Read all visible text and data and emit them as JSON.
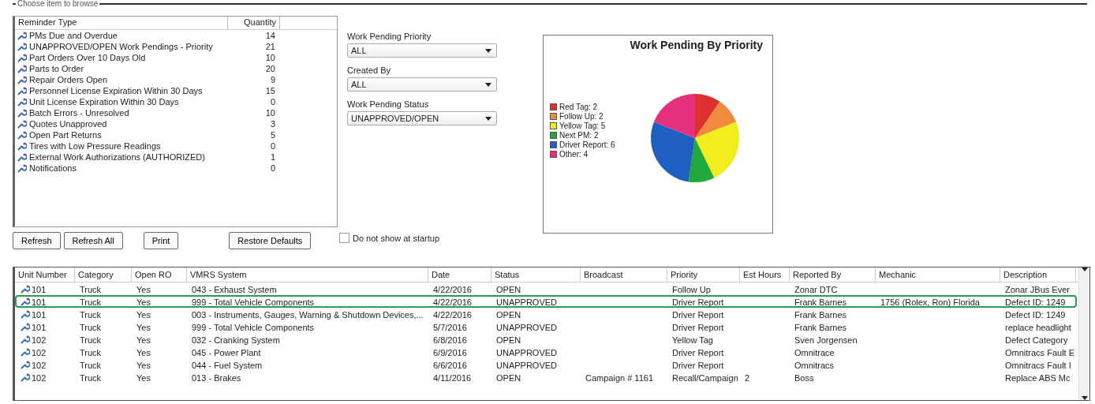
{
  "browse_group": {
    "title": "Choose item to browse"
  },
  "reminders": {
    "columns": [
      "Reminder Type",
      "Quantity"
    ],
    "rows": [
      {
        "label": "PMs Due and Overdue",
        "quantity": "14"
      },
      {
        "label": "UNAPPROVED/OPEN Work Pendings - Priority",
        "quantity": "21"
      },
      {
        "label": "Part Orders Over 10 Days Old",
        "quantity": "10"
      },
      {
        "label": "Parts to Order",
        "quantity": "20"
      },
      {
        "label": "Repair Orders Open",
        "quantity": "9"
      },
      {
        "label": "Personnel License Expiration Within 30 Days",
        "quantity": "15"
      },
      {
        "label": "Unit License Expiration Within 30 Days",
        "quantity": "0"
      },
      {
        "label": "Batch Errors - Unresolved",
        "quantity": "10"
      },
      {
        "label": "Quotes Unapproved",
        "quantity": "3"
      },
      {
        "label": "Open Part Returns",
        "quantity": "5"
      },
      {
        "label": "Tires with Low Pressure Readings",
        "quantity": "0"
      },
      {
        "label": "External Work Authorizations (AUTHORIZED)",
        "quantity": "1"
      },
      {
        "label": "Notifications",
        "quantity": "0"
      }
    ]
  },
  "filters": [
    {
      "label": "Work Pending Priority",
      "value": "ALL"
    },
    {
      "label": "Created By",
      "value": "ALL"
    },
    {
      "label": "Work Pending Status",
      "value": "UNAPPROVED/OPEN"
    }
  ],
  "buttons": [
    "Refresh",
    "Refresh All",
    "Print",
    "Restore Defaults"
  ],
  "startup_checkbox": {
    "label": "Do not show at startup",
    "checked": false
  },
  "chart": {
    "legend": [
      {
        "label": "Red Tag: 2",
        "color": "#e0302e"
      },
      {
        "label": "Follow Up: 2",
        "color": "#f08a3c"
      },
      {
        "label": "Yellow Tag: 5",
        "color": "#f2ee1e"
      },
      {
        "label": "Next PM: 2",
        "color": "#20a83e"
      },
      {
        "label": "Driver Report: 6",
        "color": "#1f5fc0"
      },
      {
        "label": "Other: 4",
        "color": "#e5307c"
      }
    ],
    "chart_data": {
      "type": "pie",
      "title": "Work Pending By Priority",
      "values": [
        9.52,
        9.52,
        23.81,
        9.52,
        28.57,
        19.06
      ]
    }
  },
  "table": {
    "columns": [
      "Unit Number",
      "Category",
      "Open RO",
      "VMRS System",
      "Date",
      "Status",
      "Broadcast",
      "Priority",
      "Est Hours",
      "Reported By",
      "Mechanic",
      "Description"
    ],
    "rows": [
      {
        "selected": false,
        "cells": [
          "101",
          "Truck",
          "Yes",
          "043 - Exhaust System",
          "4/22/2016",
          "OPEN",
          "",
          "Follow Up",
          "",
          "Zonar DTC",
          "",
          "Zonar JBus Ever"
        ]
      },
      {
        "selected": true,
        "cells": [
          "101",
          "Truck",
          "Yes",
          "999 - Total Vehicle Components",
          "4/22/2016",
          "UNAPPROVED",
          "",
          "Driver Report",
          "",
          "Frank Barnes",
          "1756 (Rolex, Ron) Florida",
          "Defect ID: 1249"
        ]
      },
      {
        "selected": false,
        "cells": [
          "101",
          "Truck",
          "Yes",
          "003 - Instruments, Gauges, Warning & Shutdown Devices,...",
          "4/22/2016",
          "OPEN",
          "",
          "Driver Report",
          "",
          "Frank Barnes",
          "",
          "Defect ID: 1249"
        ]
      },
      {
        "selected": false,
        "cells": [
          "101",
          "Truck",
          "Yes",
          "999 - Total Vehicle Components",
          "5/7/2016",
          "UNAPPROVED",
          "",
          "Driver Report",
          "",
          "Frank Barnes",
          "",
          "replace headlight"
        ]
      },
      {
        "selected": false,
        "cells": [
          "102",
          "Truck",
          "Yes",
          "032 - Cranking System",
          "6/8/2016",
          "OPEN",
          "",
          "Yellow Tag",
          "",
          "Sven Jorgensen",
          "",
          "Defect Category"
        ]
      },
      {
        "selected": false,
        "cells": [
          "102",
          "Truck",
          "Yes",
          "045 - Power Plant",
          "6/9/2016",
          "UNAPPROVED",
          "",
          "Driver Report",
          "",
          "Omnitrace",
          "",
          "Omnitracs Fault E"
        ]
      },
      {
        "selected": false,
        "cells": [
          "102",
          "Truck",
          "Yes",
          "044 - Fuel System",
          "6/6/2016",
          "UNAPPROVED",
          "",
          "Driver Report",
          "",
          "Omnitracs",
          "",
          "Omnitracs Fault I"
        ]
      },
      {
        "selected": false,
        "cells": [
          "102",
          "Truck",
          "Yes",
          "013 - Brakes",
          "4/11/2016",
          "OPEN",
          "Campaign # 1161",
          "Recall/Campaign",
          "2",
          "Boss",
          "",
          "Replace ABS Mc"
        ]
      }
    ]
  }
}
